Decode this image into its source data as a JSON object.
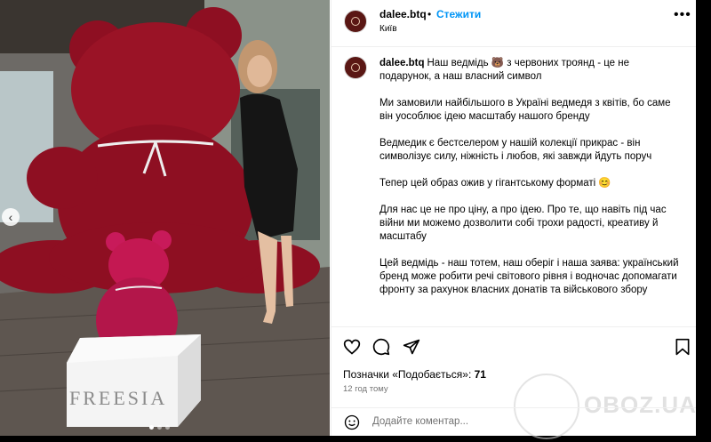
{
  "photo": {
    "brand_text": "FREESIA",
    "nav_prev": "‹",
    "dots": [
      true,
      false,
      false
    ]
  },
  "header": {
    "username": "dalee.btq",
    "dot": "•",
    "follow_label": "Стежити",
    "location": "Київ",
    "more": "•••"
  },
  "caption": {
    "username": "dalee.btq",
    "paragraphs": [
      "Наш ведмідь 🐻 з червоних троянд - це не подарунок, а наш власний символ",
      "Ми замовили найбільшого в Україні ведмедя з квітів, бо саме він уособлює ідею масштабу нашого бренду",
      "Ведмедик є бестселером у нашій колекції прикрас - він символізує силу, ніжність і любов, які завжди йдуть поруч",
      "Тепер цей образ ожив у гігантському форматі 😊",
      "Для нас це не про ціну, а про ідею. Про те, що навіть під час війни ми можемо дозволити собі трохи радості, креативу й масштабу",
      "Цей ведмідь - наш тотем, наш оберіг і наша заява: український бренд може робити речі світового рівня і водночас допомагати фронту за рахунок власних донатів та військового збору"
    ]
  },
  "actions": {
    "likes_label": "Позначки «Подобається»:",
    "likes_count": "71",
    "time_ago": "12 год тому"
  },
  "comment": {
    "placeholder": "Додайте коментар..."
  },
  "watermark": {
    "text": "OBOZ.UA"
  },
  "colors": {
    "accent": "#0095f6",
    "avatar_bg": "#5a1714",
    "rose": "#a0142a"
  }
}
